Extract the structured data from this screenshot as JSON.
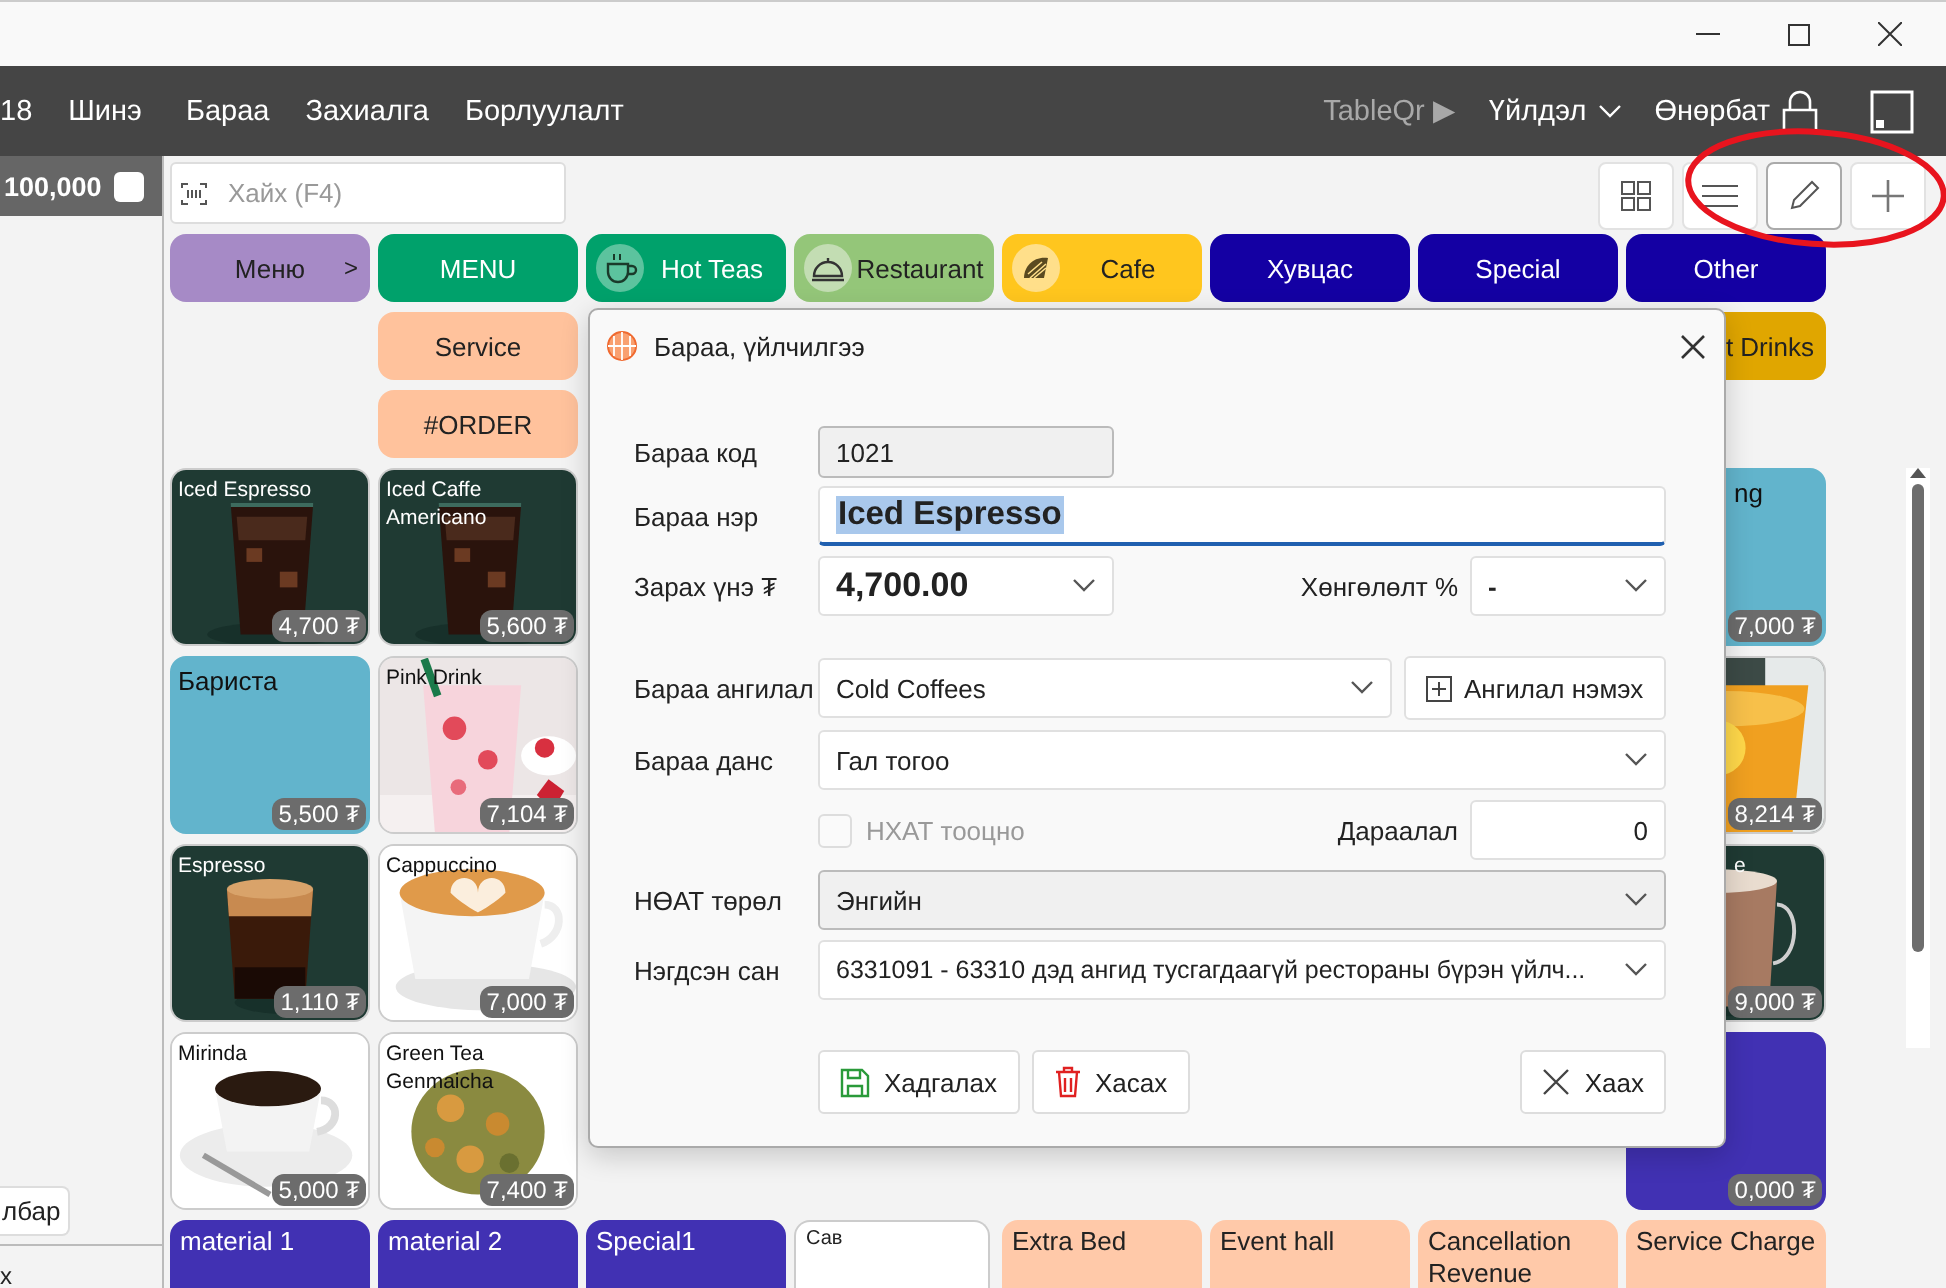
{
  "menu_bar": {
    "items": [
      "18",
      "Шинэ",
      "Бараа",
      "Захиалга",
      "Борлуулалт"
    ],
    "table_qr": "TableQr ▶",
    "actions": "Үйлдэл",
    "user": "Өнөрбат"
  },
  "balance": {
    "amount": "100,000",
    "checked": false
  },
  "search": {
    "placeholder": "Хайх (F4)"
  },
  "view_buttons": [
    {
      "kind": "grid",
      "selected": false
    },
    {
      "kind": "list",
      "selected": false
    },
    {
      "kind": "edit",
      "selected": true
    },
    {
      "kind": "add",
      "selected": false
    }
  ],
  "categories": [
    {
      "label": "Меню",
      "kind": "submenu",
      "caret": ">",
      "color": "#a68ac6"
    },
    {
      "label": "MENU",
      "kind": "plain",
      "color": "#00a16b"
    },
    {
      "label": "Hot Teas",
      "kind": "cup",
      "color": "#00a16b"
    },
    {
      "label": "Restaurant",
      "kind": "cloche",
      "color": "#94c679"
    },
    {
      "label": "Cafe",
      "kind": "cafe",
      "color": "#ffc61e"
    },
    {
      "label": "Хувцас",
      "kind": "plain",
      "color": "#1400a3"
    },
    {
      "label": "Special",
      "kind": "plain",
      "color": "#1400a3"
    },
    {
      "label": "Other",
      "kind": "plain",
      "color": "#1400a3"
    }
  ],
  "subcategories": [
    {
      "label": "Service",
      "color": "#ffc29c"
    },
    {
      "label": "#ORDER",
      "color": "#ffc29c"
    }
  ],
  "partial_category": {
    "label": "t Drinks",
    "color": "#e0a600"
  },
  "products": [
    {
      "name": "Iced Espresso",
      "price": "4,700 ₮",
      "kind": "picture"
    },
    {
      "name": "Iced Caffe Americano",
      "price": "5,600 ₮",
      "kind": "picture"
    },
    {
      "name": "Бариста",
      "price": "5,500 ₮",
      "kind": "color",
      "color": "#62b4cc"
    },
    {
      "name": "Pink Drink",
      "price": "7,104 ₮",
      "kind": "picture"
    },
    {
      "name": "Espresso",
      "price": "1,110 ₮",
      "kind": "picture"
    },
    {
      "name": "Cappuccino",
      "price": "7,000 ₮",
      "kind": "picture"
    },
    {
      "name": "Mirinda",
      "price": "5,000 ₮",
      "kind": "picture"
    },
    {
      "name": "Green Tea Genmaicha",
      "price": "7,400 ₮",
      "kind": "picture"
    }
  ],
  "partial_products": [
    {
      "name": "ng",
      "price": "7,000 ₮",
      "kind": "color",
      "color": "#62b4cc"
    },
    {
      "price": "8,214 ₮",
      "kind": "picture"
    },
    {
      "name": "e",
      "price": "9,000 ₮",
      "kind": "picture"
    },
    {
      "price": "0,000 ₮",
      "kind": "color",
      "color": "#4131b3"
    }
  ],
  "bottom_row": [
    {
      "label": "material 1",
      "color": "#4131b3"
    },
    {
      "label": "material 2",
      "color": "#4131b3"
    },
    {
      "label": "Special1",
      "color": "#4131b3"
    },
    {
      "label": "Сав",
      "color": "#ffffff"
    },
    {
      "label": "Extra Bed",
      "color": "#ffc9a9"
    },
    {
      "label": "Event hall",
      "color": "#ffc9a9"
    },
    {
      "label": "Cancellation Revenue",
      "color": "#ffc9a9"
    },
    {
      "label": "Service Charge",
      "color": "#ffc9a9"
    }
  ],
  "left_panel": {
    "button": "лбар",
    "footer": "х"
  },
  "dialog": {
    "title": "Бараа, үйлчилгээ",
    "code": {
      "label": "Бараа код",
      "value": "1021"
    },
    "name": {
      "label": "Бараа нэр",
      "value": "Iced Espresso",
      "text_selected": true
    },
    "price": {
      "label": "Зарах үнэ ₮",
      "value": "4,700.00"
    },
    "discount": {
      "label": "Хөнгөлөлт %",
      "value": "-"
    },
    "category": {
      "label": "Бараа ангилал",
      "value": "Cold Coffees",
      "add_button": "Ангилал нэмэх"
    },
    "account": {
      "label": "Бараа данс",
      "value": "Гал тогоо"
    },
    "city_tax": {
      "label": "НХАТ тооцно",
      "checked": false,
      "disabled": true
    },
    "order": {
      "label": "Дараалал",
      "value": "0"
    },
    "vat_type": {
      "label": "НӨАТ төрөл",
      "value": "Энгийн"
    },
    "classification": {
      "label": "Нэгдсэн сан",
      "value": "6331091 - 63310 дэд ангид тусгагдаагүй рестораны бүрэн үйлч..."
    },
    "buttons": [
      {
        "label": "Хадгалах",
        "kind": "save"
      },
      {
        "label": "Хасах",
        "kind": "delete"
      },
      {
        "label": "Хаах",
        "kind": "close"
      }
    ]
  }
}
